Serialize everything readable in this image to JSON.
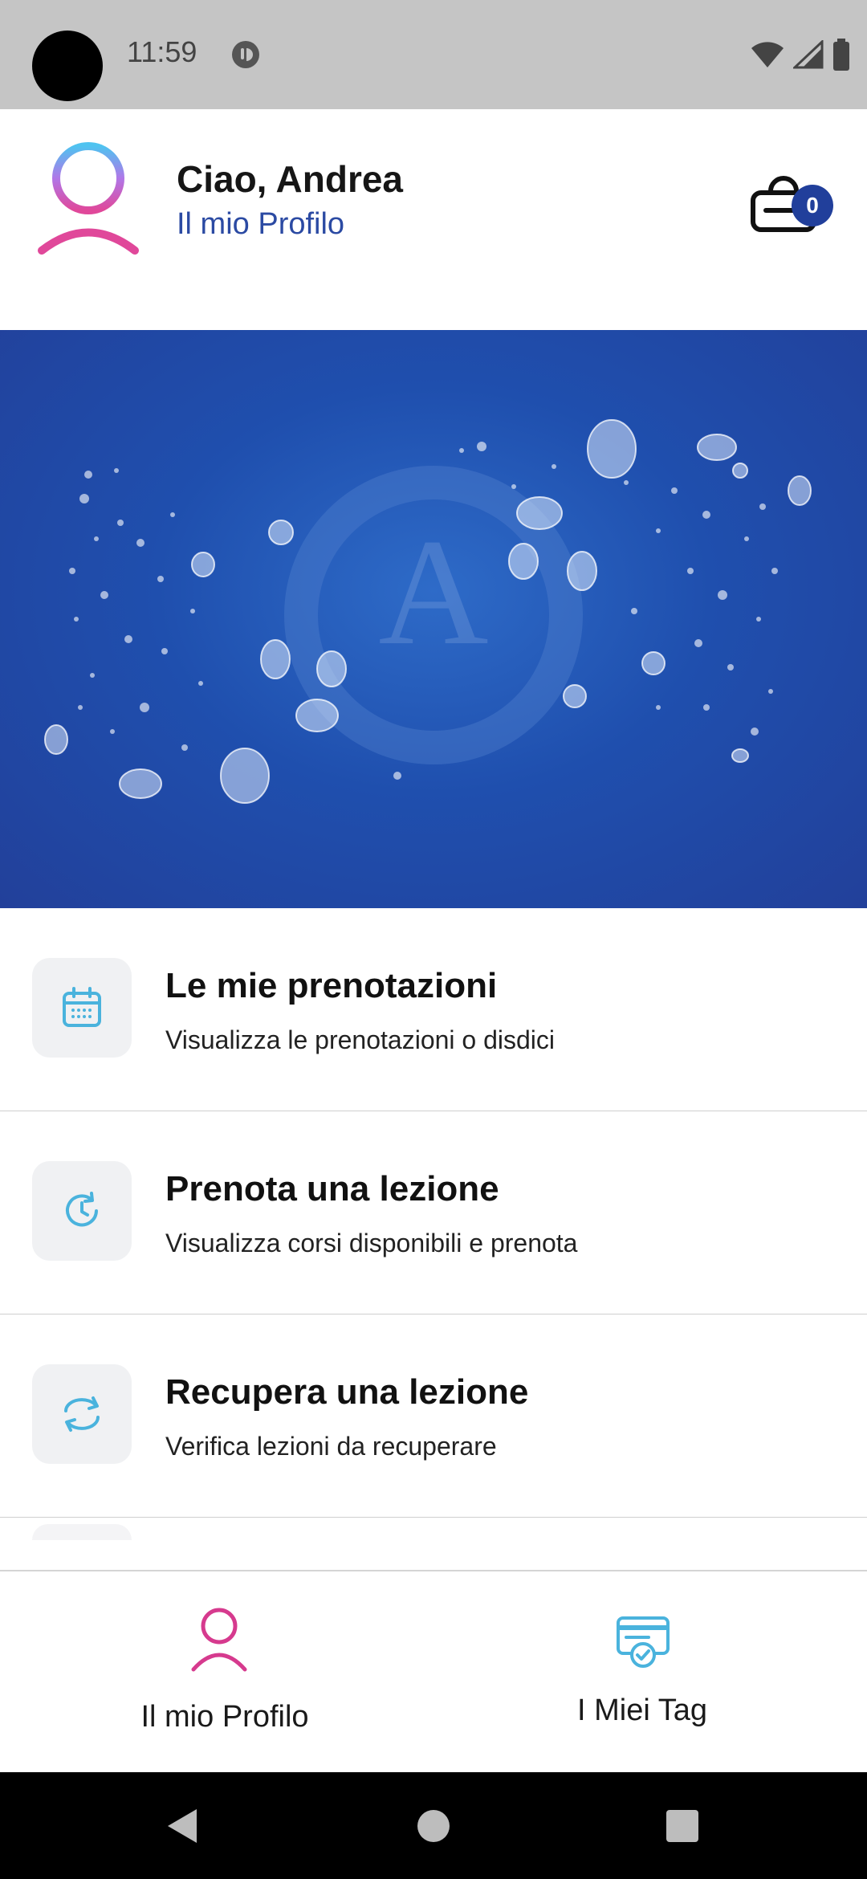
{
  "status_bar": {
    "time": "11:59",
    "icons": [
      "camera-cutout",
      "notification-icon",
      "wifi-icon",
      "signal-icon",
      "battery-icon"
    ]
  },
  "header": {
    "greeting": "Ciao, Andrea",
    "profile_link": "Il mio Profilo",
    "cart_count": "0",
    "icons": [
      "avatar-icon",
      "shopping-bag-icon"
    ]
  },
  "banner": {
    "logo_letter": "A",
    "colors": {
      "primary": "#2251a9",
      "accent": "#3d7ad6"
    }
  },
  "menu": {
    "items": [
      {
        "title": "Le mie prenotazioni",
        "subtitle": "Visualizza le prenotazioni o disdici",
        "icon": "calendar-icon"
      },
      {
        "title": "Prenota una lezione",
        "subtitle": "Visualizza corsi disponibili e prenota",
        "icon": "clock-refresh-icon"
      },
      {
        "title": "Recupera una lezione",
        "subtitle": "Verifica lezioni da recuperare",
        "icon": "sync-icon"
      }
    ]
  },
  "bottom_nav": {
    "tabs": [
      {
        "label": "Il mio Profilo",
        "icon": "person-icon",
        "active_color": "#d63a8e"
      },
      {
        "label": "I Miei Tag",
        "icon": "tag-card-icon",
        "active_color": "#4ab3dd"
      }
    ]
  },
  "system_nav": {
    "buttons": [
      "back-button",
      "home-button",
      "recents-button"
    ]
  }
}
